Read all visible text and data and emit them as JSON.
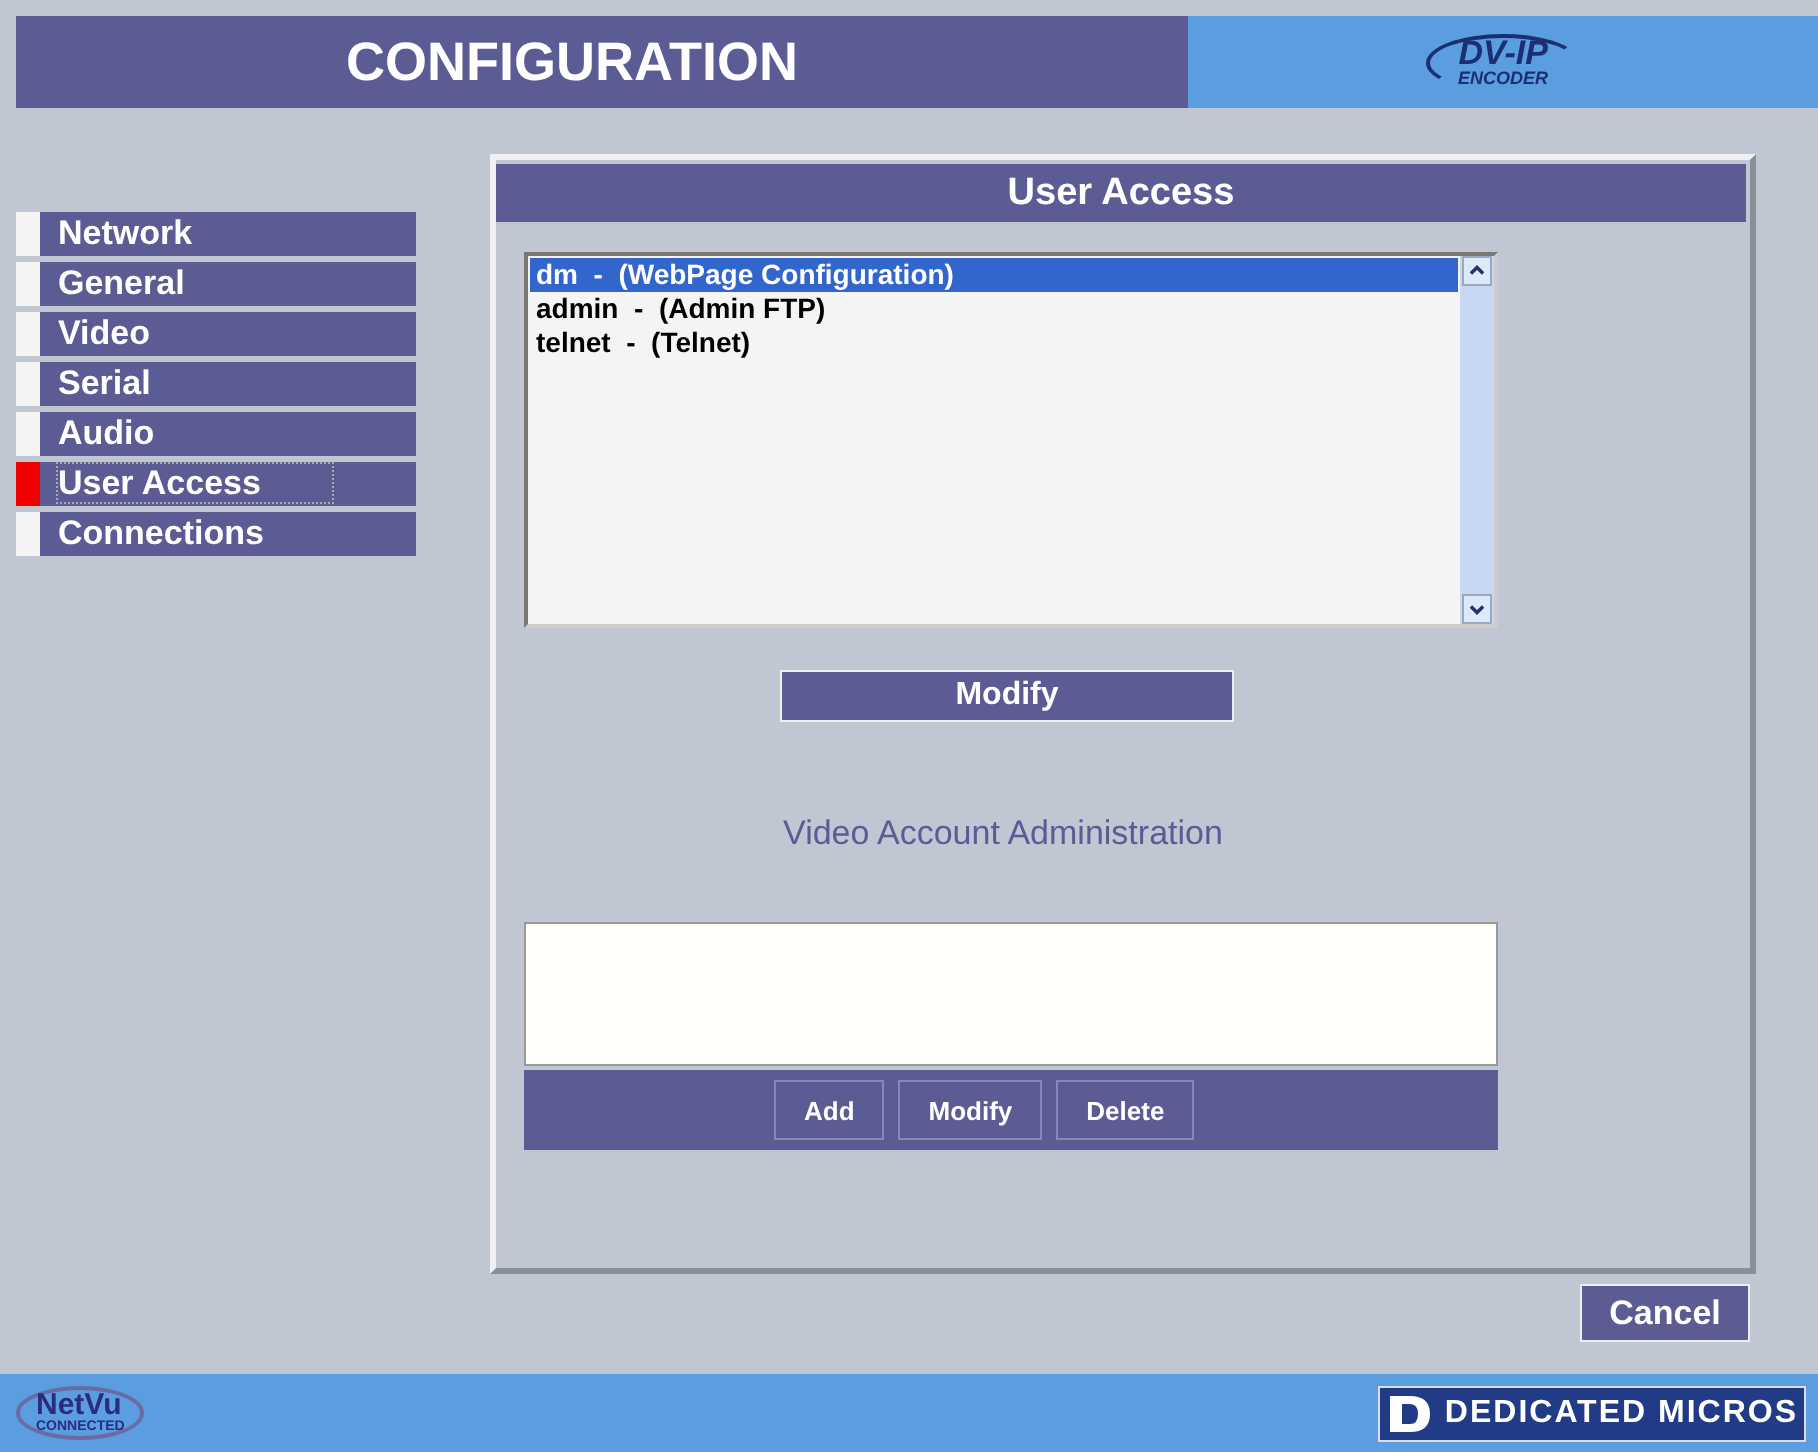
{
  "header": {
    "title": "CONFIGURATION",
    "logo": {
      "main": "DV-IP",
      "sub": "ENCODER"
    }
  },
  "sidebar": {
    "items": [
      {
        "label": "Network",
        "selected": false
      },
      {
        "label": "General",
        "selected": false
      },
      {
        "label": "Video",
        "selected": false
      },
      {
        "label": "Serial",
        "selected": false
      },
      {
        "label": "Audio",
        "selected": false
      },
      {
        "label": "User Access",
        "selected": true
      },
      {
        "label": "Connections",
        "selected": false
      }
    ]
  },
  "panel": {
    "title": "User Access",
    "users": [
      {
        "label": "dm  -  (WebPage Configuration)",
        "selected": true
      },
      {
        "label": "admin  -  (Admin FTP)",
        "selected": false
      },
      {
        "label": "telnet  -  (Telnet)",
        "selected": false
      }
    ],
    "modify_button": "Modify",
    "section_title": "Video Account Administration",
    "account_buttons": [
      "Add",
      "Modify",
      "Delete"
    ]
  },
  "cancel_button": "Cancel",
  "footer": {
    "left_logo": {
      "main": "NetVu",
      "sub": "CONNECTED"
    },
    "right_logo": "DEDICATED MICROS"
  }
}
